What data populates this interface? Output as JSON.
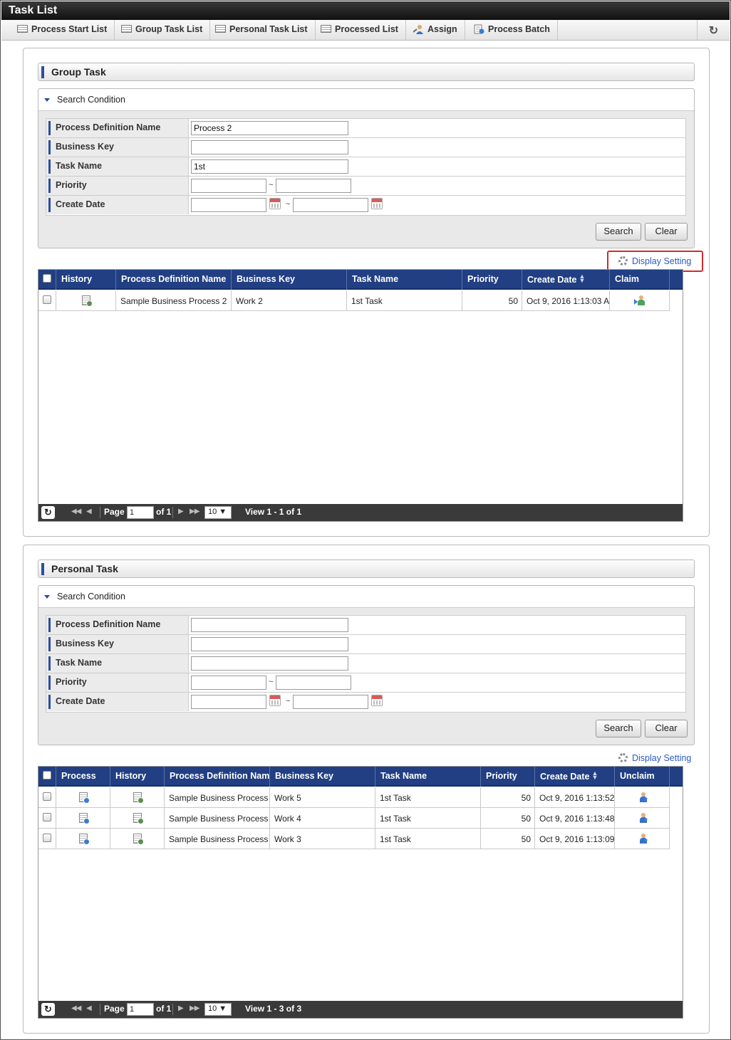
{
  "app": {
    "title": "Task List"
  },
  "tabs": [
    {
      "label": "Process Start List"
    },
    {
      "label": "Group Task List"
    },
    {
      "label": "Personal Task List"
    },
    {
      "label": "Processed List"
    },
    {
      "label": "Assign"
    },
    {
      "label": "Process Batch"
    }
  ],
  "group": {
    "title": "Group Task",
    "search": {
      "heading": "Search Condition",
      "labels": {
        "proc_def": "Process Definition Name",
        "business_key": "Business Key",
        "task_name": "Task Name",
        "priority": "Priority",
        "create_date": "Create Date"
      },
      "values": {
        "proc_def": "Process 2",
        "business_key": "",
        "task_name": "1st",
        "priority_from": "",
        "priority_to": "",
        "date_from": "",
        "date_to": ""
      },
      "tilde": "~",
      "search_btn": "Search",
      "clear_btn": "Clear"
    },
    "display_setting": "Display Setting",
    "columns": {
      "history": "History",
      "proc_def": "Process Definition Name",
      "business_key": "Business Key",
      "task_name": "Task Name",
      "priority": "Priority",
      "create_date": "Create Date",
      "claim": "Claim"
    },
    "rows": [
      {
        "proc_def": "Sample Business Process 2",
        "business_key": "Work 2",
        "task_name": "1st Task",
        "priority": "50",
        "create_date": "Oct 9, 2016 1:13:03 A"
      }
    ],
    "pager": {
      "page_label": "Page",
      "page": "1",
      "of_label": "of 1",
      "page_size": "10 ▼",
      "view": "View 1 - 1 of 1"
    }
  },
  "personal": {
    "title": "Personal Task",
    "search": {
      "heading": "Search Condition",
      "labels": {
        "proc_def": "Process Definition Name",
        "business_key": "Business Key",
        "task_name": "Task Name",
        "priority": "Priority",
        "create_date": "Create Date"
      },
      "values": {
        "proc_def": "",
        "business_key": "",
        "task_name": "",
        "priority_from": "",
        "priority_to": "",
        "date_from": "",
        "date_to": ""
      },
      "tilde": "~",
      "search_btn": "Search",
      "clear_btn": "Clear"
    },
    "display_setting": "Display Setting",
    "columns": {
      "process": "Process",
      "history": "History",
      "proc_def": "Process Definition Name",
      "business_key": "Business Key",
      "task_name": "Task Name",
      "priority": "Priority",
      "create_date": "Create Date",
      "unclaim": "Unclaim"
    },
    "rows": [
      {
        "proc_def": "Sample Business Process",
        "business_key": "Work 5",
        "task_name": "1st Task",
        "priority": "50",
        "create_date": "Oct 9, 2016 1:13:52"
      },
      {
        "proc_def": "Sample Business Process",
        "business_key": "Work 4",
        "task_name": "1st Task",
        "priority": "50",
        "create_date": "Oct 9, 2016 1:13:48"
      },
      {
        "proc_def": "Sample Business Process",
        "business_key": "Work 3",
        "task_name": "1st Task",
        "priority": "50",
        "create_date": "Oct 9, 2016 1:13:09"
      }
    ],
    "pager": {
      "page_label": "Page",
      "page": "1",
      "of_label": "of 1",
      "page_size": "10 ▼",
      "view": "View 1 - 3 of 3"
    }
  }
}
